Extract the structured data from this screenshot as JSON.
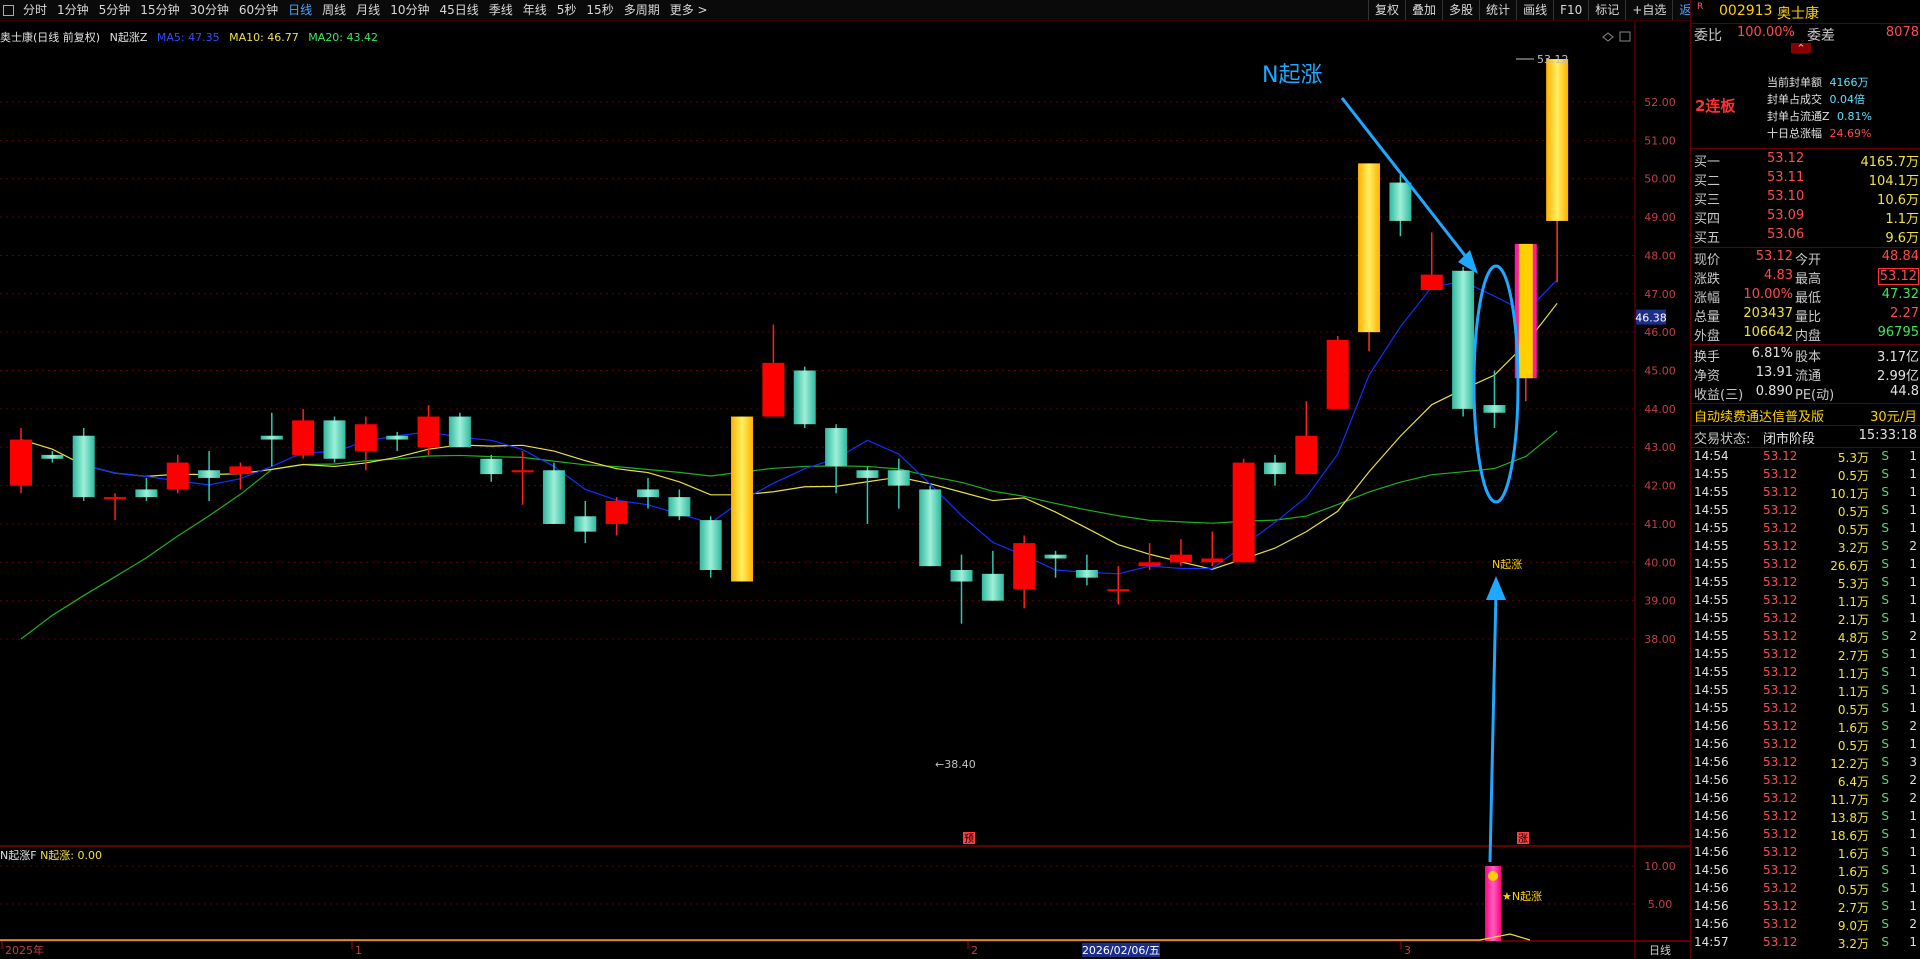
{
  "toolbar": {
    "periods": [
      "分时",
      "1分钟",
      "5分钟",
      "15分钟",
      "30分钟",
      "60分钟",
      "日线",
      "周线",
      "月线",
      "10分钟",
      "45日线",
      "季线",
      "年线",
      "5秒",
      "15秒",
      "多周期",
      "更多 >"
    ],
    "active_period": "日线",
    "tools": [
      "复权",
      "叠加",
      "多股",
      "统计",
      "画线",
      "F10",
      "标记",
      "+自选",
      "返回"
    ]
  },
  "chart_info": {
    "stock_label": "奥士康(日线 前复权)",
    "indicator": "N起涨Z",
    "ma5": "MA5: 47.35",
    "ma10": "MA10: 46.77",
    "ma20": "MA20: 43.42"
  },
  "sub_info": {
    "name": "N起涨F",
    "value": "N起涨: 0.00"
  },
  "annotations": {
    "big_label": "N起涨",
    "small_label": "N起涨",
    "sub_label": "★N起涨",
    "high_label": "53.12",
    "low_label": "38.40",
    "marker_yu": "预",
    "marker_zhang": "涨",
    "cursor_price": "46.38"
  },
  "price_axis": [
    "52.00",
    "51.00",
    "50.00",
    "49.00",
    "48.00",
    "47.00",
    "46.00",
    "45.00",
    "44.00",
    "43.00",
    "42.00",
    "41.00",
    "40.00",
    "39.00",
    "38.00"
  ],
  "sub_axis": [
    "10.00",
    "5.00"
  ],
  "date_axis": {
    "start": "2025年",
    "m1": "1",
    "m2": "2",
    "m3": "3",
    "selected": "2026/02/06/五",
    "period": "日线"
  },
  "colors": {
    "bg": "#000000",
    "up": "#ff0000",
    "down": "#40e0c0",
    "limit": "#ffd000",
    "ma5": "#1030ff",
    "ma10": "#e8e040",
    "ma20": "#20b020",
    "arrow": "#1ea8ff"
  },
  "candles": [
    [
      42.0,
      43.2,
      41.8,
      43.5,
      "u"
    ],
    [
      42.8,
      42.7,
      42.6,
      42.9,
      "d"
    ],
    [
      43.3,
      41.7,
      41.6,
      43.5,
      "d"
    ],
    [
      41.7,
      41.7,
      41.1,
      41.8,
      "u"
    ],
    [
      41.7,
      41.9,
      41.6,
      42.2,
      "d"
    ],
    [
      41.9,
      42.6,
      41.8,
      42.8,
      "u"
    ],
    [
      42.4,
      42.2,
      41.6,
      42.9,
      "d"
    ],
    [
      42.3,
      42.5,
      41.9,
      42.6,
      "u"
    ],
    [
      43.2,
      43.3,
      42.5,
      43.9,
      "d"
    ],
    [
      42.8,
      43.7,
      42.7,
      44.0,
      "u"
    ],
    [
      43.7,
      42.7,
      42.6,
      43.8,
      "d"
    ],
    [
      42.9,
      43.6,
      42.4,
      43.8,
      "u"
    ],
    [
      43.3,
      43.2,
      42.9,
      43.4,
      "d"
    ],
    [
      43.0,
      43.8,
      42.8,
      44.1,
      "u"
    ],
    [
      43.8,
      43.0,
      43.0,
      43.9,
      "d"
    ],
    [
      42.7,
      42.3,
      42.1,
      42.8,
      "d"
    ],
    [
      42.4,
      42.4,
      41.5,
      42.9,
      "u"
    ],
    [
      42.4,
      41.0,
      41.0,
      42.6,
      "d"
    ],
    [
      41.2,
      40.8,
      40.5,
      41.6,
      "d"
    ],
    [
      41.0,
      41.6,
      40.7,
      41.7,
      "u"
    ],
    [
      41.9,
      41.7,
      41.4,
      42.2,
      "d"
    ],
    [
      41.7,
      41.2,
      41.1,
      41.9,
      "d"
    ],
    [
      41.1,
      39.8,
      39.6,
      41.2,
      "d"
    ],
    [
      39.5,
      43.8,
      39.5,
      43.8,
      "L"
    ],
    [
      45.2,
      43.8,
      43.8,
      46.2,
      "u"
    ],
    [
      45.0,
      43.6,
      43.5,
      45.1,
      "d"
    ],
    [
      43.5,
      42.5,
      41.8,
      43.6,
      "d"
    ],
    [
      42.4,
      42.2,
      41.0,
      42.5,
      "d"
    ],
    [
      42.4,
      42.0,
      41.4,
      42.7,
      "d"
    ],
    [
      41.9,
      39.9,
      39.9,
      42.0,
      "d"
    ],
    [
      39.8,
      39.5,
      38.4,
      40.2,
      "d"
    ],
    [
      39.7,
      39.0,
      39.0,
      40.3,
      "d"
    ],
    [
      39.3,
      40.5,
      38.8,
      40.7,
      "u"
    ],
    [
      40.2,
      40.1,
      39.6,
      40.3,
      "d"
    ],
    [
      39.8,
      39.6,
      39.4,
      40.2,
      "d"
    ],
    [
      39.3,
      39.3,
      38.9,
      39.9,
      "u"
    ],
    [
      39.9,
      40.0,
      39.8,
      40.5,
      "u"
    ],
    [
      40.0,
      40.2,
      39.9,
      40.6,
      "u"
    ],
    [
      40.0,
      40.1,
      39.9,
      40.8,
      "u"
    ],
    [
      40.0,
      42.6,
      40.0,
      42.7,
      "u"
    ],
    [
      42.6,
      42.3,
      42.0,
      42.8,
      "d"
    ],
    [
      42.3,
      43.3,
      42.3,
      44.2,
      "u"
    ],
    [
      44.0,
      45.8,
      44.0,
      45.9,
      "u"
    ],
    [
      46.0,
      50.4,
      45.5,
      50.4,
      "L"
    ],
    [
      49.9,
      48.9,
      48.5,
      50.1,
      "d"
    ],
    [
      47.1,
      47.5,
      47.1,
      48.6,
      "u"
    ],
    [
      47.6,
      44.0,
      43.8,
      47.7,
      "d"
    ],
    [
      44.1,
      43.9,
      43.5,
      45.0,
      "d"
    ],
    [
      44.8,
      48.3,
      44.2,
      48.3,
      "P"
    ],
    [
      48.9,
      53.12,
      47.3,
      53.12,
      "L"
    ]
  ]
}
